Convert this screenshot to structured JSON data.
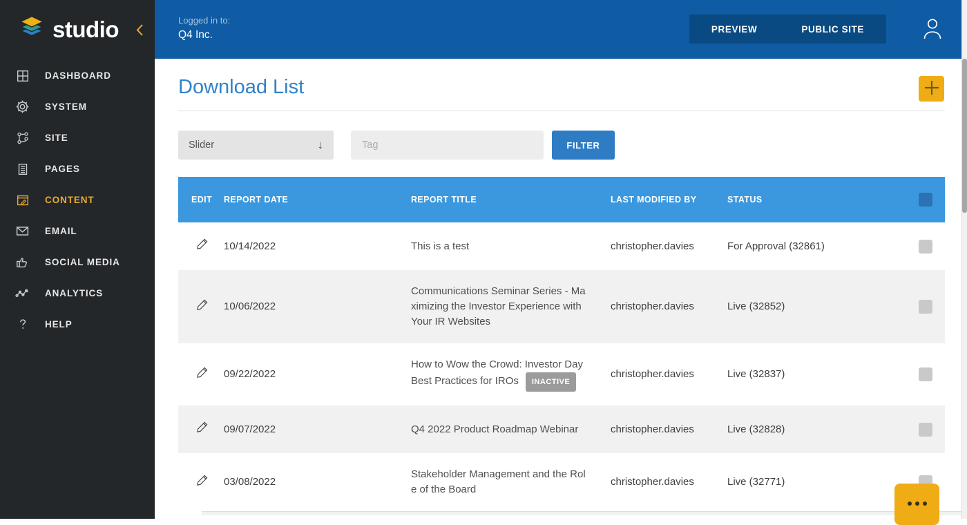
{
  "brand": {
    "name": "studio",
    "logo_icon": "layers-stack-icon",
    "collapse_icon": "chevron-left-icon"
  },
  "sidebar": {
    "items": [
      {
        "label": "DASHBOARD",
        "icon": "grid-icon",
        "active": false
      },
      {
        "label": "SYSTEM",
        "icon": "gear-icon",
        "active": false
      },
      {
        "label": "SITE",
        "icon": "sitemap-icon",
        "active": false
      },
      {
        "label": "PAGES",
        "icon": "document-icon",
        "active": false
      },
      {
        "label": "CONTENT",
        "icon": "edit-window-icon",
        "active": true
      },
      {
        "label": "EMAIL",
        "icon": "envelope-icon",
        "active": false
      },
      {
        "label": "SOCIAL MEDIA",
        "icon": "thumbs-up-icon",
        "active": false
      },
      {
        "label": "ANALYTICS",
        "icon": "line-chart-icon",
        "active": false
      },
      {
        "label": "HELP",
        "icon": "question-icon",
        "active": false
      }
    ]
  },
  "topbar": {
    "logged_in_label": "Logged in to:",
    "account": "Q4 Inc.",
    "preview_label": "PREVIEW",
    "public_site_label": "PUBLIC SITE",
    "user_icon": "user-icon"
  },
  "page": {
    "title": "Download List",
    "add_button_icon": "plus-icon"
  },
  "filters": {
    "type_value": "Slider",
    "type_arrow_icon": "down-arrow-icon",
    "tag_placeholder": "Tag",
    "filter_label": "FILTER"
  },
  "table": {
    "headers": [
      "EDIT",
      "REPORT DATE",
      "REPORT TITLE",
      "LAST MODIFIED BY",
      "STATUS"
    ],
    "rows": [
      {
        "date": "10/14/2022",
        "title": "This is a test",
        "badge": null,
        "modified_by": "christopher.davies",
        "status": "For Approval (32861)"
      },
      {
        "date": "10/06/2022",
        "title": "Communications Seminar Series - Maximizing the Investor Experience with Your IR Websites",
        "badge": null,
        "modified_by": "christopher.davies",
        "status": "Live (32852)"
      },
      {
        "date": "09/22/2022",
        "title": "How to Wow the Crowd: Investor Day Best Practices for IROs",
        "badge": "INACTIVE",
        "modified_by": "christopher.davies",
        "status": "Live (32837)"
      },
      {
        "date": "09/07/2022",
        "title": "Q4 2022 Product Roadmap Webinar",
        "badge": null,
        "modified_by": "christopher.davies",
        "status": "Live (32828)"
      },
      {
        "date": "03/08/2022",
        "title": "Stakeholder Management and the Role of the Board",
        "badge": null,
        "modified_by": "christopher.davies",
        "status": "Live (32771)"
      }
    ]
  },
  "fab": {
    "icon": "ellipsis-icon"
  },
  "colors": {
    "accent_gold": "#F0AC15",
    "active_nav_gold": "#EDAB2D",
    "topbar_blue": "#0F5BA4",
    "topbar_button_blue": "#0A4A82",
    "table_header_blue": "#3B98DF",
    "header_checkbox_blue": "#2B72B4",
    "primary_button_blue": "#2E7CC3",
    "page_title_blue": "#3181CA",
    "sidebar_bg": "#23272A",
    "zebra_row_gray": "#F1F1F1",
    "badge_gray": "#9B9B9B",
    "logo_layers": [
      "#EEB111",
      "#2E9B8F",
      "#2F80C6"
    ]
  }
}
